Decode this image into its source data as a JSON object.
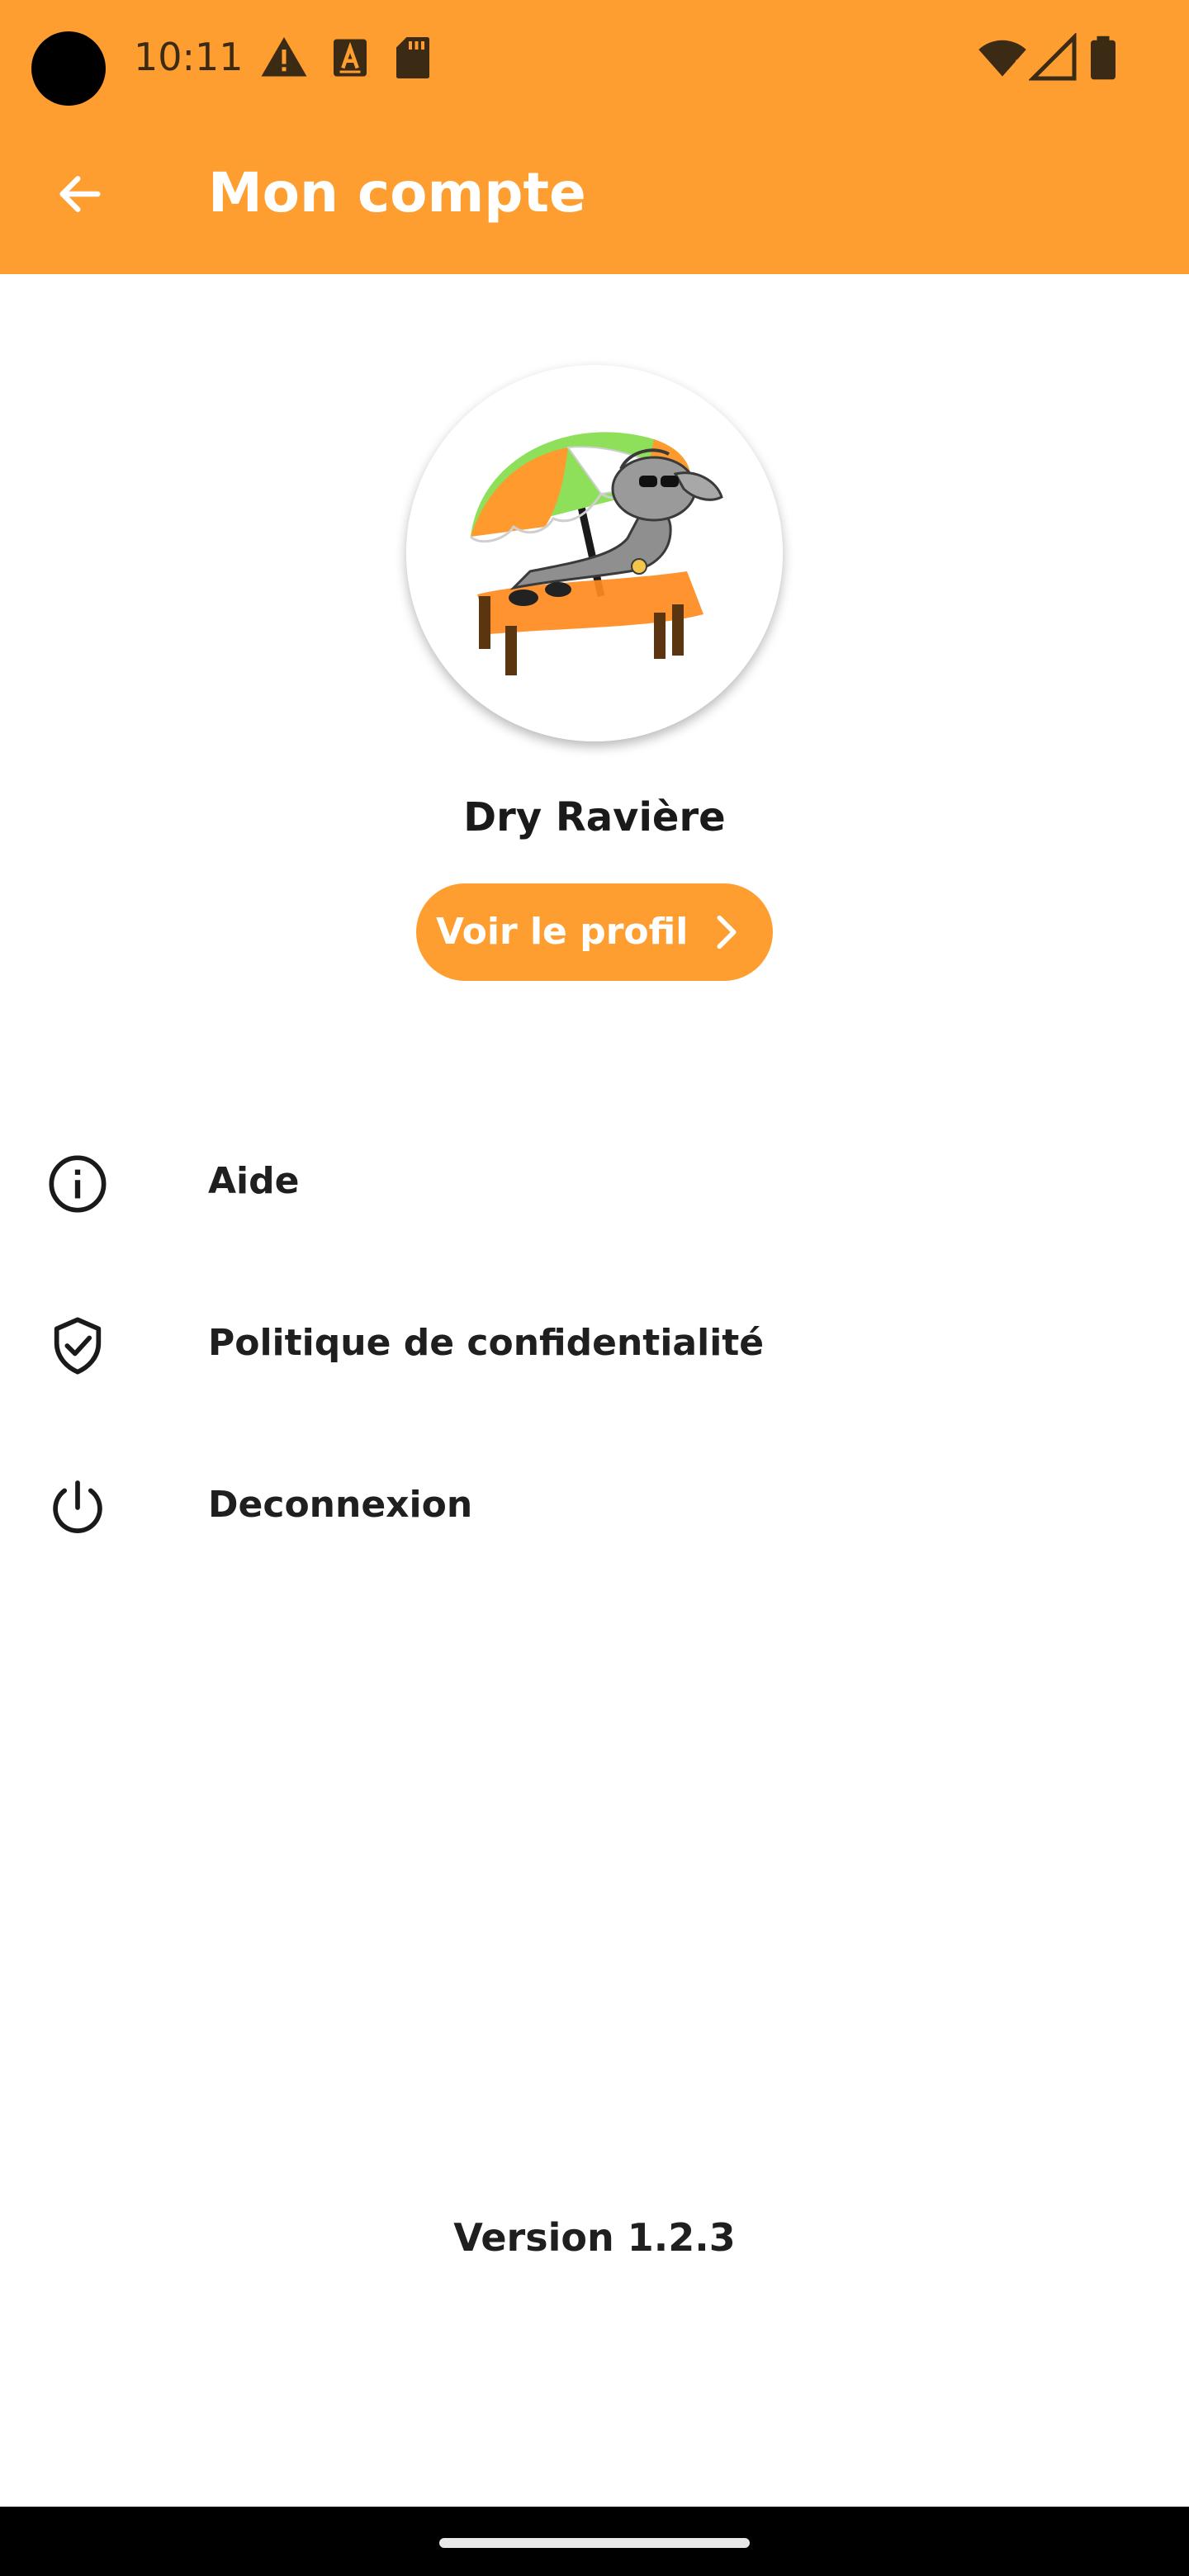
{
  "status_bar": {
    "time": "10:11",
    "icons": [
      "warning-icon",
      "font-a-icon",
      "sd-card-icon",
      "wifi-icon",
      "signal-icon",
      "battery-icon"
    ]
  },
  "app_bar": {
    "title": "Mon compte",
    "back_icon": "arrow-back-icon"
  },
  "profile": {
    "name": "Dry Ravière",
    "view_profile_label": "Voir le profil"
  },
  "menu": {
    "items": [
      {
        "label": "Aide",
        "icon": "info-icon"
      },
      {
        "label": "Politique de confidentialité",
        "icon": "shield-check-icon"
      },
      {
        "label": "Deconnexion",
        "icon": "power-icon"
      }
    ]
  },
  "footer": {
    "version": "Version 1.2.3"
  },
  "colors": {
    "accent": "#FF9E30",
    "text": "#1f1f1f",
    "background": "#ffffff"
  }
}
